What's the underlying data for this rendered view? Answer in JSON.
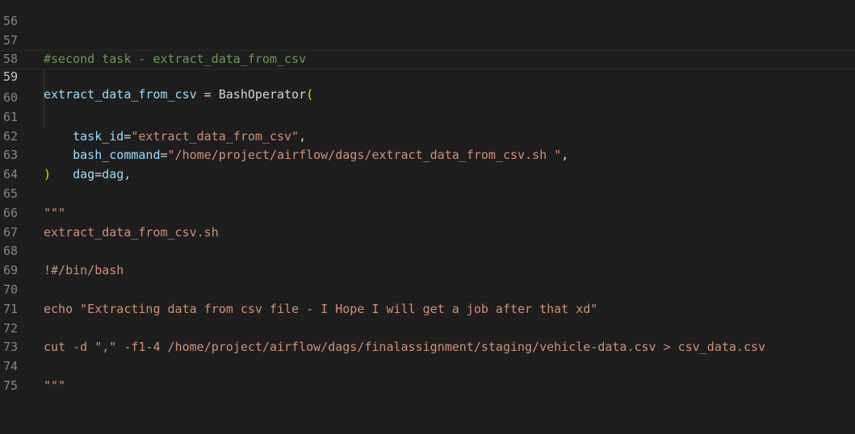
{
  "colors": {
    "background": "#1e1e1e",
    "line_number": "#858585",
    "line_number_active": "#c6c6c6",
    "comment": "#6a9955",
    "variable": "#9cdcfe",
    "string": "#ce9178",
    "bracket": "#ffd700",
    "default": "#d4d4d4"
  },
  "lines": [
    {
      "n": "56",
      "t": ""
    },
    {
      "n": "57",
      "t": "#second task - extract_data_from_csv"
    },
    {
      "n": "58",
      "t": ""
    },
    {
      "n": "59",
      "a": "extract_data_from_csv",
      "b": " = BashOperator",
      "c": "("
    },
    {
      "n": "60",
      "a": "    task_id",
      "b": "=",
      "c": "\"extract_data_from_csv\"",
      "d": ","
    },
    {
      "n": "61",
      "a": "    bash_command",
      "b": "=",
      "c": "\"/home/project/airflow/dags/extract_data_from_csv.sh \"",
      "d": ","
    },
    {
      "n": "62",
      "a": "    dag",
      "b": "=",
      "c": "dag",
      "d": ","
    },
    {
      "n": "63",
      "t": ")"
    },
    {
      "n": "64",
      "t": ""
    },
    {
      "n": "65",
      "t": "\"\"\""
    },
    {
      "n": "66",
      "t": "extract_data_from_csv.sh"
    },
    {
      "n": "67",
      "t": ""
    },
    {
      "n": "68",
      "t": "!#/bin/bash"
    },
    {
      "n": "69",
      "t": ""
    },
    {
      "n": "70",
      "t": "echo \"Extracting data from csv file - I Hope I will get a job after that xd\""
    },
    {
      "n": "71",
      "t": ""
    },
    {
      "n": "72",
      "t": "cut -d \",\" -f1-4 /home/project/airflow/dags/finalassignment/staging/vehicle-data.csv > csv_data.csv"
    },
    {
      "n": "73",
      "t": ""
    },
    {
      "n": "74",
      "t": "\"\"\""
    },
    {
      "n": "75",
      "t": ""
    }
  ]
}
